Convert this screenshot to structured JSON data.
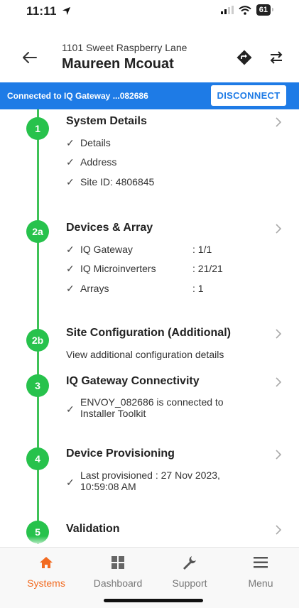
{
  "status_bar": {
    "time": "11:11",
    "battery": "61"
  },
  "header": {
    "address": "1101 Sweet Raspberry Lane",
    "name": "Maureen Mcouat"
  },
  "banner": {
    "text": "Connected to IQ Gateway ...082686",
    "button": "DISCONNECT"
  },
  "steps": [
    {
      "badge": "1",
      "title": "System Details",
      "checks": [
        "Details",
        "Address",
        "Site ID: 4806845"
      ]
    },
    {
      "badge": "2a",
      "title": "Devices & Array",
      "items": [
        {
          "label": "IQ Gateway",
          "value": ": 1/1"
        },
        {
          "label": "IQ Microinverters",
          "value": ": 21/21"
        },
        {
          "label": "Arrays",
          "value": ": 1"
        }
      ]
    },
    {
      "badge": "2b",
      "title": "Site Configuration (Additional)",
      "description": "View additional configuration details"
    },
    {
      "badge": "3",
      "title": "IQ Gateway Connectivity",
      "check_line1": "ENVOY_082686 is connected to",
      "check_line2": "Installer Toolkit"
    },
    {
      "badge": "4",
      "title": "Device Provisioning",
      "check_line1": "Last provisioned : 27 Nov 2023,",
      "check_line2": "10:59:08 AM"
    },
    {
      "badge": "5",
      "title": "Validation"
    }
  ],
  "bottom_nav": {
    "items": [
      {
        "label": "Systems",
        "icon": "home-icon"
      },
      {
        "label": "Dashboard",
        "icon": "dashboard-icon"
      },
      {
        "label": "Support",
        "icon": "wrench-icon"
      },
      {
        "label": "Menu",
        "icon": "menu-icon"
      }
    ],
    "active": "Systems",
    "active_color": "#f26b21"
  },
  "colors": {
    "accent_blue": "#1e7be6",
    "step_green": "#27c24c"
  }
}
